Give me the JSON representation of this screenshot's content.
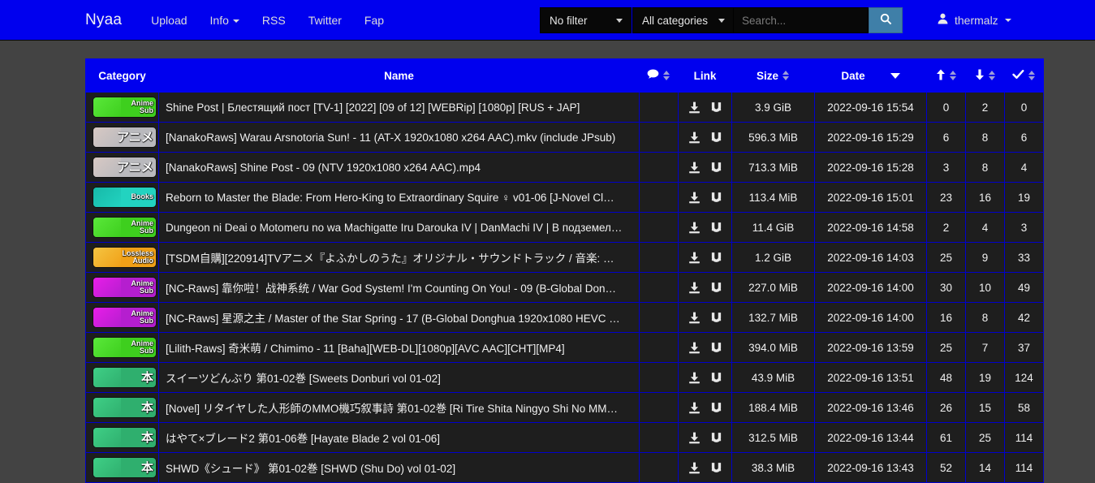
{
  "navbar": {
    "brand": "Nyaa",
    "links": [
      {
        "label": "Upload",
        "caret": false
      },
      {
        "label": "Info",
        "caret": true
      },
      {
        "label": "RSS",
        "caret": false
      },
      {
        "label": "Twitter",
        "caret": false
      },
      {
        "label": "Fap",
        "caret": false
      }
    ],
    "filter_select": "No filter",
    "category_select": "All categories",
    "search_placeholder": "Search...",
    "search_value": "",
    "search_icon": "search-icon",
    "user": {
      "name": "thermalz",
      "icon": "user-icon"
    },
    "background_color": "#0000ee"
  },
  "table": {
    "headers": {
      "category": "Category",
      "name": "Name",
      "comments_icon": "comments-icon",
      "link": "Link",
      "size": "Size",
      "date": "Date",
      "seeders_icon": "arrow-up-icon",
      "leechers_icon": "arrow-down-icon",
      "completed_icon": "check-icon"
    },
    "active_sort": "date-descending",
    "rows": [
      {
        "category": {
          "label_lines": [
            "Anime",
            "Sub"
          ],
          "color": "#3ecf1e",
          "thumb": "#5ae83a"
        },
        "name": "Shine Post | Блестящий пост [TV-1] [2022] [09 of 12] [WEBRip] [1080p] [RUS + JAP]",
        "size": "3.9 GiB",
        "date": "2022-09-16 15:54",
        "seeders": "0",
        "leechers": "2",
        "completed": "0"
      },
      {
        "category": {
          "label_lines": [
            "アニメ"
          ],
          "color": "#b9b9bd",
          "thumb": "#d8c9c4",
          "big": true
        },
        "name": "[NanakoRaws] Warau Arsnotoria Sun! - 11 (AT-X 1920x1080 x264 AAC).mkv (include JPsub)",
        "size": "596.3 MiB",
        "date": "2022-09-16 15:29",
        "seeders": "6",
        "leechers": "8",
        "completed": "6"
      },
      {
        "category": {
          "label_lines": [
            "アニメ"
          ],
          "color": "#b9b9bd",
          "thumb": "#d8c9c4",
          "big": true
        },
        "name": "[NanakoRaws] Shine Post - 09 (NTV 1920x1080 x264 AAC).mp4",
        "size": "713.3 MiB",
        "date": "2022-09-16 15:28",
        "seeders": "3",
        "leechers": "8",
        "completed": "4"
      },
      {
        "category": {
          "label_lines": [
            "Books"
          ],
          "color": "#22d3c0",
          "thumb": "#17b9a8"
        },
        "name": "Reborn to Master the Blade: From Hero-King to Extraordinary Squire ♀ v01-06 [J-Novel Cl…",
        "size": "113.4 MiB",
        "date": "2022-09-16 15:01",
        "seeders": "23",
        "leechers": "16",
        "completed": "19"
      },
      {
        "category": {
          "label_lines": [
            "Anime",
            "Sub"
          ],
          "color": "#3ecf1e",
          "thumb": "#5ae83a"
        },
        "name": "Dungeon ni Deai o Motomeru no wa Machigatte Iru Darouka IV | DanMachi IV | В подземел…",
        "size": "11.4 GiB",
        "date": "2022-09-16 14:58",
        "seeders": "2",
        "leechers": "4",
        "completed": "3"
      },
      {
        "category": {
          "label_lines": [
            "Lossless",
            "Audio"
          ],
          "color": "#f0a017",
          "thumb": "#f5c542"
        },
        "name": "[TSDM自購][220914]TVアニメ『よふかしのうた』オリジナル・サウンドトラック / 音楽: …",
        "size": "1.2 GiB",
        "date": "2022-09-16 14:03",
        "seeders": "25",
        "leechers": "9",
        "completed": "33"
      },
      {
        "category": {
          "label_lines": [
            "Anime",
            "Sub"
          ],
          "color": "#b51ecf",
          "thumb": "#e81ee8"
        },
        "name": "[NC-Raws] 靠你啦！战神系统 / War God System! I'm Counting On You! - 09 (B-Global Don…",
        "size": "227.0 MiB",
        "date": "2022-09-16 14:00",
        "seeders": "30",
        "leechers": "10",
        "completed": "49"
      },
      {
        "category": {
          "label_lines": [
            "Anime",
            "Sub"
          ],
          "color": "#b51ecf",
          "thumb": "#e81ee8"
        },
        "name": "[NC-Raws] 星源之主 / Master of the Star Spring - 17 (B-Global Donghua 1920x1080 HEVC …",
        "size": "132.7 MiB",
        "date": "2022-09-16 14:00",
        "seeders": "16",
        "leechers": "8",
        "completed": "42"
      },
      {
        "category": {
          "label_lines": [
            "Anime",
            "Sub"
          ],
          "color": "#3ecf1e",
          "thumb": "#5ae83a"
        },
        "name": "[Lilith-Raws] 奇米萌 / Chimimo - 11 [Baha][WEB-DL][1080p][AVC AAC][CHT][MP4]",
        "size": "394.0 MiB",
        "date": "2022-09-16 13:59",
        "seeders": "25",
        "leechers": "7",
        "completed": "37"
      },
      {
        "category": {
          "label_lines": [
            "本"
          ],
          "color": "#2faf6e",
          "thumb": "#3fcf86",
          "big": true
        },
        "name": "スイーツどんぶり 第01-02巻 [Sweets Donburi vol 01-02]",
        "size": "43.9 MiB",
        "date": "2022-09-16 13:51",
        "seeders": "48",
        "leechers": "19",
        "completed": "124"
      },
      {
        "category": {
          "label_lines": [
            "本"
          ],
          "color": "#2faf6e",
          "thumb": "#3fcf86",
          "big": true
        },
        "name": "[Novel] リタイヤした人形師のMMO機巧叙事詩 第01-02巻 [Ri Tire Shita Ningyo Shi No MM…",
        "size": "188.4 MiB",
        "date": "2022-09-16 13:46",
        "seeders": "26",
        "leechers": "15",
        "completed": "58"
      },
      {
        "category": {
          "label_lines": [
            "本"
          ],
          "color": "#2faf6e",
          "thumb": "#3fcf86",
          "big": true
        },
        "name": "はやて×ブレード2 第01-06巻 [Hayate Blade 2 vol 01-06]",
        "size": "312.5 MiB",
        "date": "2022-09-16 13:44",
        "seeders": "61",
        "leechers": "25",
        "completed": "114"
      },
      {
        "category": {
          "label_lines": [
            "本"
          ],
          "color": "#2faf6e",
          "thumb": "#3fcf86",
          "big": true
        },
        "name": "SHWD《シュード》 第01-02巻 [SHWD (Shu Do) vol 01-02]",
        "size": "38.3 MiB",
        "date": "2022-09-16 13:43",
        "seeders": "52",
        "leechers": "14",
        "completed": "114"
      }
    ],
    "row_link_icons": [
      "download-icon",
      "magnet-icon"
    ]
  },
  "colors": {
    "page_background": "#434343",
    "navbar": "#0000ee",
    "row_background": "#1e1e1e",
    "row_border": "#0000cd",
    "search_button": "#3f7fa8"
  }
}
